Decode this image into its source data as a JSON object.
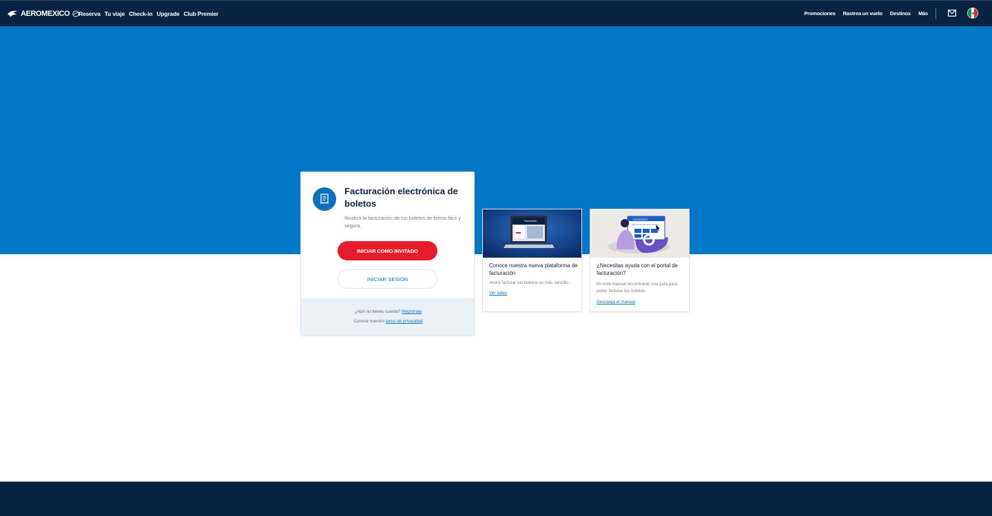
{
  "header": {
    "brand": "AEROMEXICO",
    "nav_left": [
      "Reserva",
      "Tu viaje",
      "Check-in",
      "Upgrade",
      "Club Premier"
    ],
    "nav_right": [
      "Promociones",
      "Rastrea un vuelo",
      "Destinos",
      "Más"
    ],
    "icons": {
      "mail": "mail-icon",
      "country": "mexico-flag-icon"
    }
  },
  "colors": {
    "navy": "#0b2343",
    "hero_blue": "#0277c5",
    "accent_red": "#e41c2c",
    "link_blue": "#0f70b7",
    "footer_tint": "#eaf2f7"
  },
  "main_card": {
    "icon": "invoice-document-icon",
    "title": "Facturación electrónica de boletos",
    "description": "Realiza la facturación de tus boletos de forma fácil y segura.",
    "guest_button": "INICIAR COMO INVITADO",
    "login_button": "INICIAR SESIÓN",
    "register_prompt": "¿Aún no tienes cuenta?",
    "register_link": "Regístrate",
    "privacy_prompt": "Conoce nuestro",
    "privacy_link": "aviso de privacidad"
  },
  "info_cards": [
    {
      "image": "laptop-billing-platform-image",
      "image_text": "Facturación",
      "title": "Conoce nuestra nueva plataforma de facturación",
      "description": "Ahora facturar tus boletos es más sencillo.",
      "link": "Ver video"
    },
    {
      "image": "billing-help-illustration",
      "image_text": "Facturación",
      "title": "¿Necesitas ayuda con el portal de facturación?",
      "description": "En este manual encontrarás una guía para poder facturar tus boletos.",
      "link": "Descarga el manual"
    }
  ]
}
